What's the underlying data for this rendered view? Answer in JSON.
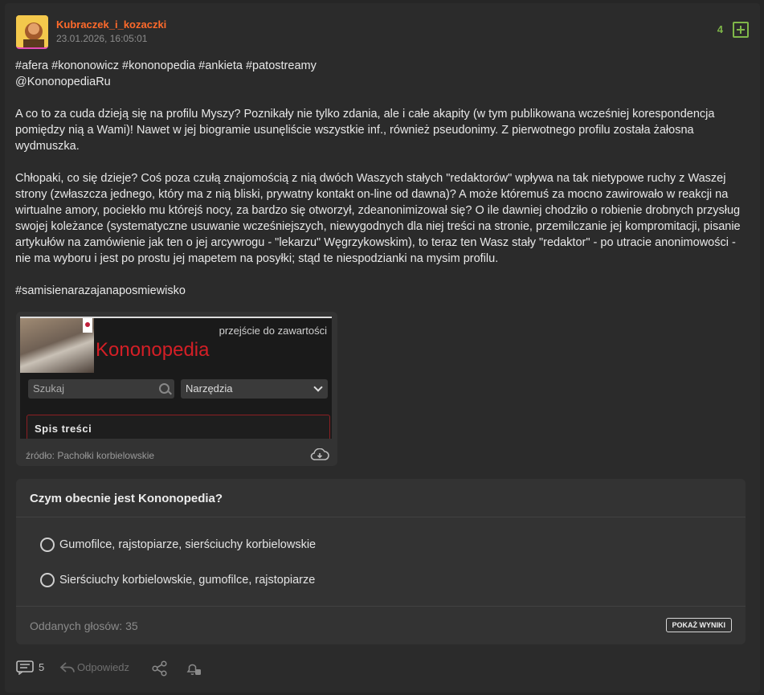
{
  "post": {
    "author": "Kubraczek_i_kozaczki",
    "date": "23.01.2026, 16:05:01",
    "votes": "4",
    "tags_line": "#afera #kononowicz #kononopedia #ankieta #patostreamy",
    "mention_line": "@KononopediaRu",
    "paragraphs": [
      "A co to za cuda dzieją się na profilu Myszy? Poznikały nie tylko zdania, ale i całe akapity (w tym publikowana wcześniej korespondencja pomiędzy nią a Wami)! Nawet w jej biogramie usunęliście wszystkie inf., również pseudonimy. Z pierwotnego profilu została żałosna wydmuszka.",
      "Chłopaki, co się dzieje? Coś poza czułą znajomością z nią dwóch Waszych stałych \"redaktorów\" wpływa na tak nietypowe ruchy z Waszej strony (zwłaszcza jednego, który ma z nią bliski, prywatny kontakt on-line od dawna)? A może któremuś za mocno zawirowało w reakcji na wirtualne amory, pociekło mu którejś nocy, za bardzo się otworzył, zdeanonimizował się? O ile dawniej chodziło o robienie drobnych przysług swojej koleżance (systematyczne usuwanie wcześniejszych, niewygodnych dla niej treści na stronie, przemilczanie jej kompromitacji, pisanie artykułów na zamówienie jak ten o jej arcywrogu - \"lekarzu\" Węgrzykowskim), to teraz ten Wasz stały \"redaktor\" - po utracie anonimowości - nie ma wyboru i jest po prostu jej mapetem na posyłki; stąd te niespodzianki na mysim profilu."
    ],
    "closing_tag": "#samisienarazajanaposmiewisko"
  },
  "embed": {
    "skip_link": "przejście do zawartości",
    "logo_text": "Kononopedia",
    "search_placeholder": "Szukaj",
    "tools_select": "Narzędzia",
    "toc_label": "Spis treści",
    "source": "źródło: Pachołki korbielowskie"
  },
  "poll": {
    "question": "Czym obecnie jest Kononopedia?",
    "options": [
      "Gumofilce, rajstopiarze, sierściuchy korbielowskie",
      "Sierściuchy korbielowskie, gumofilce, rajstopiarze"
    ],
    "votes_cast": "Oddanych głosów: 35",
    "results_button": "POKAŻ WYNIKI"
  },
  "actions": {
    "comment_count": "5",
    "reply_label": "Odpowiedz"
  },
  "colors": {
    "author": "#ff6a2b",
    "vote_accent": "#7fb749",
    "logo_red": "#d41f26"
  }
}
